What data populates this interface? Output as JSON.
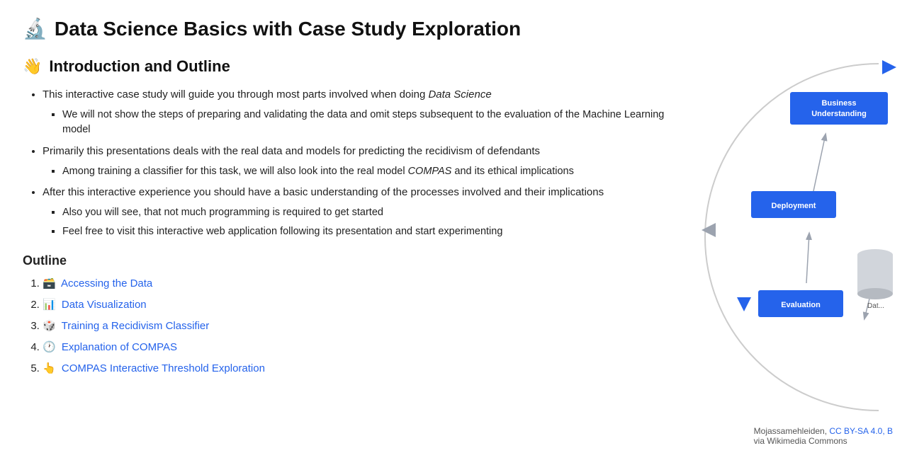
{
  "page": {
    "title": "Data Science Basics with Case Study Exploration",
    "title_icon": "🔬",
    "section": {
      "icon": "👋",
      "heading": "Introduction and Outline"
    },
    "bullets": [
      {
        "text_before_italic": "This interactive case study will guide you through most parts involved when doing ",
        "text_italic": "Data Science",
        "text_after_italic": "",
        "sub_items": [
          "We will not show the steps of preparing and validating the data and omit steps subsequent to the evaluation of the Machine Learning model"
        ]
      },
      {
        "text": "Primarily this presentations deals with the real data and models for predicting the recidivism of defendants",
        "sub_items": [
          "Among training a classifier for this task, we will also look into the real model COMPAS and its ethical implications"
        ]
      },
      {
        "text": "After this interactive experience you should have a basic understanding of the processes involved and their implications",
        "sub_items": [
          "Also you will see, that not much programming is required to get started",
          "Feel free to visit this interactive web application following its presentation and start experimenting"
        ]
      }
    ],
    "outline_heading": "Outline",
    "outline_items": [
      {
        "icon": "🗃️",
        "text": "Accessing the Data"
      },
      {
        "icon": "📊",
        "text": "Data Visualization"
      },
      {
        "icon": "🎲",
        "text": "Training a Recidivism Classifier"
      },
      {
        "icon": "🕐",
        "text": "Explanation of COMPAS"
      },
      {
        "icon": "👆",
        "text": "COMPAS Interactive Threshold Exploration"
      }
    ]
  },
  "diagram": {
    "boxes": [
      {
        "label": "Business\nUnderstanding",
        "id": "business"
      },
      {
        "label": "Deployment",
        "id": "deployment"
      },
      {
        "label": "Evaluation",
        "id": "evaluation"
      }
    ],
    "data_label": "Dat...",
    "attribution_text": "Mojassamehleiden, ",
    "attribution_link_text": "CC BY-SA 4.0, B",
    "attribution_link_href": "#",
    "attribution_suffix": "via Wikimedia Commons"
  }
}
